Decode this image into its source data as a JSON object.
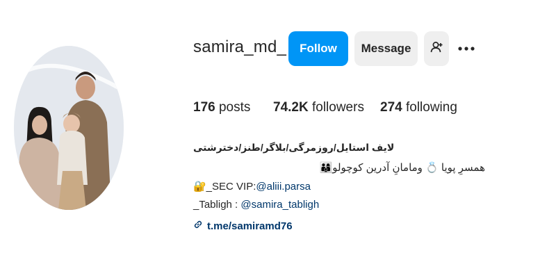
{
  "profile": {
    "username": "samira_md_",
    "follow_label": "Follow",
    "message_label": "Message",
    "add_user_icon": "person-add-icon",
    "more_icon": "ellipsis-icon"
  },
  "stats": {
    "posts_count": "176",
    "posts_label": "posts",
    "followers_count": "74.2K",
    "followers_label": "followers",
    "following_count": "274",
    "following_label": "following"
  },
  "bio": {
    "name": "لایف استایل/روزمرگی/بلاگر/طنز/دخترشتی",
    "line1": "همسرِ پویا 💍 ومامانِ آدرین کوچولو👨‍👩‍👦",
    "line2_prefix": "🔐_SEC VIP:",
    "line2_mention": "@aliii.parsa",
    "line3_prefix": "_Tabligh : ",
    "line3_mention": "@samira_tabligh",
    "link": "t.me/samiramd76"
  },
  "colors": {
    "accent": "#0095f6",
    "link": "#00376b",
    "button_secondary": "#efefef"
  }
}
